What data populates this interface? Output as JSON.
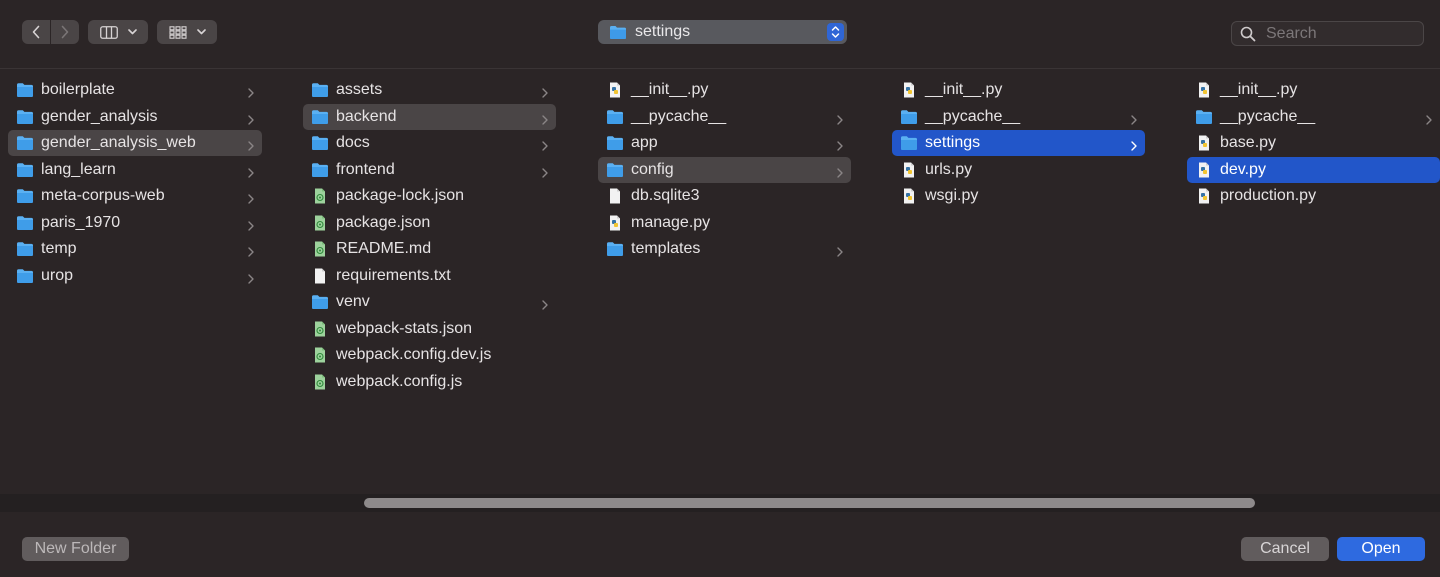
{
  "toolbar": {
    "back_icon": "chevron-left-icon",
    "forward_icon": "chevron-right-icon",
    "view_columns_icon": "columns-view-icon",
    "view_grid_icon": "grid-view-icon",
    "path_popup_label": "settings",
    "search_placeholder": "Search"
  },
  "columns": [
    {
      "items": [
        {
          "name": "boilerplate",
          "type": "folder",
          "has_children": true
        },
        {
          "name": "gender_analysis",
          "type": "folder",
          "has_children": true
        },
        {
          "name": "gender_analysis_web",
          "type": "folder",
          "has_children": true,
          "selected": "gray"
        },
        {
          "name": "lang_learn",
          "type": "folder",
          "has_children": true
        },
        {
          "name": "meta-corpus-web",
          "type": "folder",
          "has_children": true
        },
        {
          "name": "paris_1970",
          "type": "folder",
          "has_children": true
        },
        {
          "name": "temp",
          "type": "folder",
          "has_children": true
        },
        {
          "name": "urop",
          "type": "folder",
          "has_children": true
        }
      ]
    },
    {
      "items": [
        {
          "name": "assets",
          "type": "folder",
          "has_children": true
        },
        {
          "name": "backend",
          "type": "folder",
          "has_children": true,
          "selected": "gray"
        },
        {
          "name": "docs",
          "type": "folder",
          "has_children": true
        },
        {
          "name": "frontend",
          "type": "folder",
          "has_children": true
        },
        {
          "name": "package-lock.json",
          "type": "js",
          "has_children": false
        },
        {
          "name": "package.json",
          "type": "js",
          "has_children": false
        },
        {
          "name": "README.md",
          "type": "js",
          "has_children": false
        },
        {
          "name": "requirements.txt",
          "type": "doc",
          "has_children": false
        },
        {
          "name": "venv",
          "type": "folder",
          "has_children": true
        },
        {
          "name": "webpack-stats.json",
          "type": "js",
          "has_children": false
        },
        {
          "name": "webpack.config.dev.js",
          "type": "js",
          "has_children": false
        },
        {
          "name": "webpack.config.js",
          "type": "js",
          "has_children": false
        }
      ]
    },
    {
      "items": [
        {
          "name": "__init__.py",
          "type": "py",
          "has_children": false
        },
        {
          "name": "__pycache__",
          "type": "folder",
          "has_children": true
        },
        {
          "name": "app",
          "type": "folder",
          "has_children": true
        },
        {
          "name": "config",
          "type": "folder",
          "has_children": true,
          "selected": "gray"
        },
        {
          "name": "db.sqlite3",
          "type": "doc",
          "has_children": false
        },
        {
          "name": "manage.py",
          "type": "py",
          "has_children": false
        },
        {
          "name": "templates",
          "type": "folder",
          "has_children": true
        }
      ]
    },
    {
      "items": [
        {
          "name": "__init__.py",
          "type": "py",
          "has_children": false
        },
        {
          "name": "__pycache__",
          "type": "folder",
          "has_children": true
        },
        {
          "name": "settings",
          "type": "folder",
          "has_children": true,
          "selected": "blue"
        },
        {
          "name": "urls.py",
          "type": "py",
          "has_children": false
        },
        {
          "name": "wsgi.py",
          "type": "py",
          "has_children": false
        }
      ]
    },
    {
      "items": [
        {
          "name": "__init__.py",
          "type": "py",
          "has_children": false
        },
        {
          "name": "__pycache__",
          "type": "folder",
          "has_children": true
        },
        {
          "name": "base.py",
          "type": "py",
          "has_children": false
        },
        {
          "name": "dev.py",
          "type": "py",
          "has_children": false,
          "selected": "blue"
        },
        {
          "name": "production.py",
          "type": "py",
          "has_children": false
        }
      ]
    }
  ],
  "footer": {
    "new_folder_label": "New Folder",
    "cancel_label": "Cancel",
    "open_label": "Open"
  },
  "colors": {
    "background": "#2b2526",
    "selection_gray": "#4a4546",
    "selection_blue": "#2256c9",
    "folder": "#5ab0f2",
    "accent": "#2e6ae0"
  }
}
